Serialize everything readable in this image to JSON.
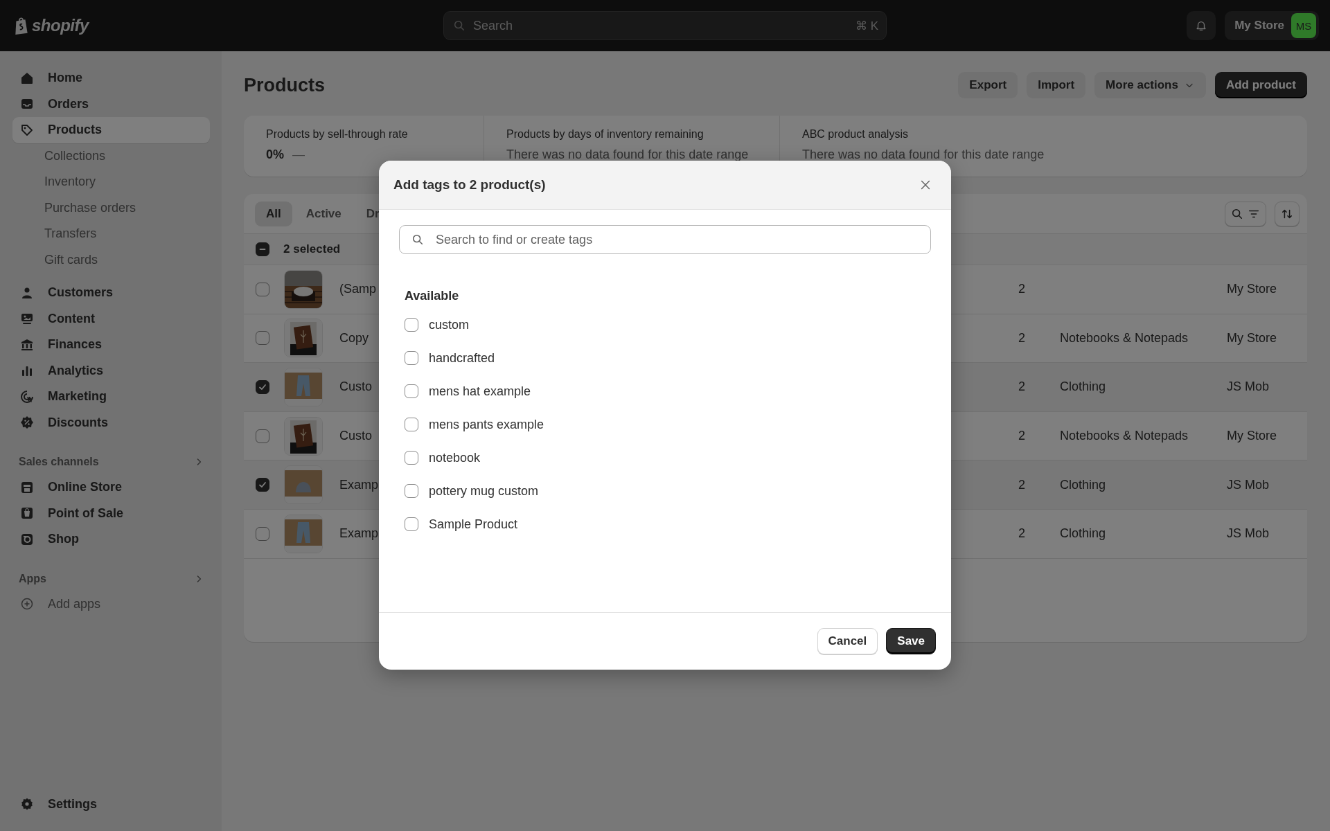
{
  "topbar": {
    "logo": "shopify",
    "search": {
      "placeholder": "Search",
      "shortcut": "⌘ K"
    },
    "store": {
      "name": "My Store",
      "initials": "MS",
      "color": "#2f7a29"
    }
  },
  "sidebar": {
    "items": [
      {
        "label": "Home",
        "kind": "main",
        "selected": false
      },
      {
        "label": "Orders",
        "kind": "main",
        "selected": false
      },
      {
        "label": "Products",
        "kind": "main",
        "selected": true
      },
      {
        "label": "Collections",
        "kind": "sub",
        "selected": false
      },
      {
        "label": "Inventory",
        "kind": "sub",
        "selected": false
      },
      {
        "label": "Purchase orders",
        "kind": "sub",
        "selected": false
      },
      {
        "label": "Transfers",
        "kind": "sub",
        "selected": false
      },
      {
        "label": "Gift cards",
        "kind": "sub",
        "selected": false
      },
      {
        "label": "Customers",
        "kind": "main",
        "selected": false
      },
      {
        "label": "Content",
        "kind": "main",
        "selected": false
      },
      {
        "label": "Finances",
        "kind": "main",
        "selected": false
      },
      {
        "label": "Analytics",
        "kind": "main",
        "selected": false
      },
      {
        "label": "Marketing",
        "kind": "main",
        "selected": false
      },
      {
        "label": "Discounts",
        "kind": "main",
        "selected": false
      }
    ],
    "sales_channels": {
      "title": "Sales channels",
      "items": [
        {
          "label": "Online Store"
        },
        {
          "label": "Point of Sale"
        },
        {
          "label": "Shop"
        }
      ]
    },
    "apps": {
      "title": "Apps",
      "items": [
        {
          "label": "Add apps"
        }
      ]
    },
    "settings": {
      "label": "Settings"
    }
  },
  "page": {
    "title": "Products",
    "actions": [
      {
        "label": "Export",
        "kind": "plain"
      },
      {
        "label": "Import",
        "kind": "plain"
      },
      {
        "label": "More actions",
        "kind": "menu"
      },
      {
        "label": "Add product",
        "kind": "primary"
      }
    ]
  },
  "analytics": [
    {
      "title": "Products by sell-through rate",
      "value": "0%",
      "trend": "—"
    },
    {
      "title": "Products by days of inventory remaining",
      "note": "There was no data found for this date range"
    },
    {
      "title": "ABC product analysis",
      "note": "There was no data found for this date range"
    }
  ],
  "table": {
    "tabs": [
      {
        "label": "All",
        "selected": true
      },
      {
        "label": "Active",
        "selected": false
      },
      {
        "label": "Dr",
        "selected": false
      }
    ],
    "bulk": {
      "label": "2 selected",
      "indeterminate": true
    },
    "rows": [
      {
        "name": "(Samp",
        "checked": false,
        "inventory": "2",
        "vendor": "My Store"
      },
      {
        "name": "Copy",
        "checked": false,
        "inventory": "2",
        "category": "Notebooks & Notepads",
        "vendor": "My Store"
      },
      {
        "name": "Custo",
        "checked": true,
        "inventory": "2",
        "category": "Clothing",
        "vendor": "JS Mob"
      },
      {
        "name": "Custo",
        "checked": false,
        "inventory": "2",
        "category": "Notebooks & Notepads",
        "vendor": "My Store"
      },
      {
        "name": "Examp",
        "checked": true,
        "inventory": "2",
        "category": "Clothing",
        "vendor": "JS Mob"
      },
      {
        "name": "Examp",
        "checked": false,
        "inventory": "2",
        "category": "Clothing",
        "vendor": "JS Mob"
      }
    ]
  },
  "modal": {
    "title": "Add tags to 2 product(s)",
    "search": {
      "placeholder": "Search to find or create tags"
    },
    "section": "Available",
    "tags": [
      {
        "label": "custom",
        "checked": false
      },
      {
        "label": "handcrafted",
        "checked": false
      },
      {
        "label": "mens hat example",
        "checked": false
      },
      {
        "label": "mens pants example",
        "checked": false
      },
      {
        "label": "notebook",
        "checked": false
      },
      {
        "label": "pottery mug custom",
        "checked": false
      },
      {
        "label": "Sample Product",
        "checked": false
      }
    ],
    "buttons": [
      {
        "label": "Cancel",
        "kind": "secondary"
      },
      {
        "label": "Save",
        "kind": "primary"
      }
    ]
  }
}
